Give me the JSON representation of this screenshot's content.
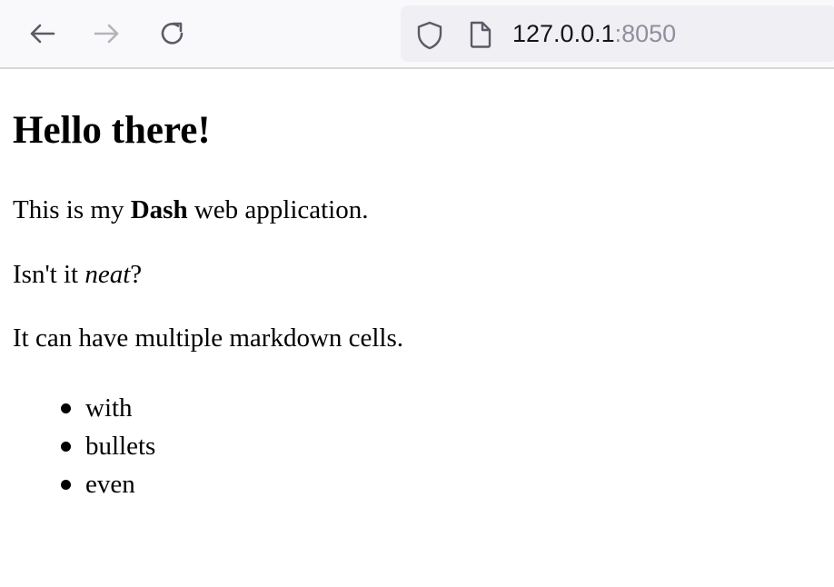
{
  "browser": {
    "toolbar_bg": "#f9f9fb",
    "icons": {
      "back": "arrow-left-icon",
      "forward": "arrow-right-icon",
      "reload": "reload-icon",
      "tracking_protection": "shield-icon",
      "page_info": "page-icon"
    },
    "forward_enabled": false,
    "url_host": "127.0.0.1",
    "url_port": ":8050"
  },
  "page": {
    "heading": "Hello there!",
    "para1": {
      "before": "This is my ",
      "bold": "Dash",
      "after": " web application."
    },
    "para2": {
      "before": "Isn't it ",
      "italic": "neat",
      "after": "?"
    },
    "para3": "It can have multiple markdown cells.",
    "bullets": [
      "with",
      "bullets",
      "even"
    ]
  }
}
